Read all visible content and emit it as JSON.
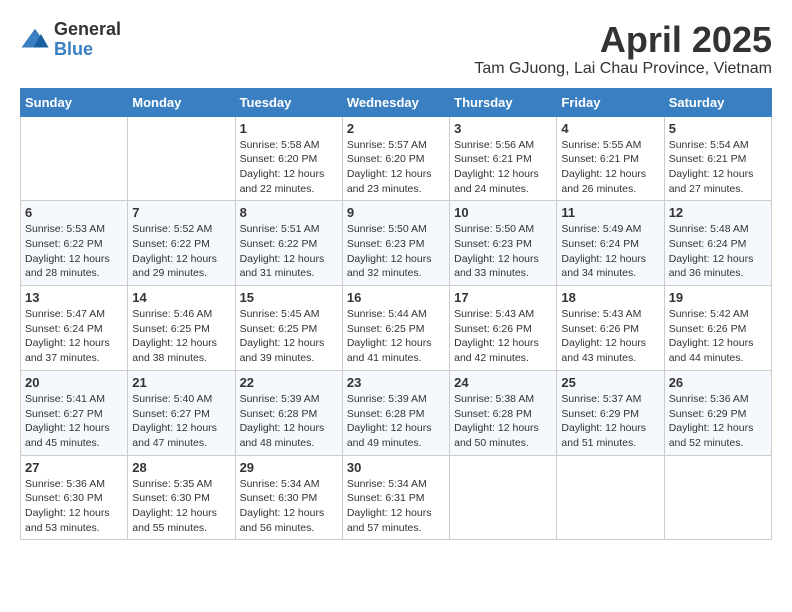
{
  "logo": {
    "general": "General",
    "blue": "Blue"
  },
  "header": {
    "month": "April 2025",
    "location": "Tam GJuong, Lai Chau Province, Vietnam"
  },
  "weekdays": [
    "Sunday",
    "Monday",
    "Tuesday",
    "Wednesday",
    "Thursday",
    "Friday",
    "Saturday"
  ],
  "weeks": [
    [
      {
        "day": "",
        "content": ""
      },
      {
        "day": "",
        "content": ""
      },
      {
        "day": "1",
        "content": "Sunrise: 5:58 AM\nSunset: 6:20 PM\nDaylight: 12 hours and 22 minutes."
      },
      {
        "day": "2",
        "content": "Sunrise: 5:57 AM\nSunset: 6:20 PM\nDaylight: 12 hours and 23 minutes."
      },
      {
        "day": "3",
        "content": "Sunrise: 5:56 AM\nSunset: 6:21 PM\nDaylight: 12 hours and 24 minutes."
      },
      {
        "day": "4",
        "content": "Sunrise: 5:55 AM\nSunset: 6:21 PM\nDaylight: 12 hours and 26 minutes."
      },
      {
        "day": "5",
        "content": "Sunrise: 5:54 AM\nSunset: 6:21 PM\nDaylight: 12 hours and 27 minutes."
      }
    ],
    [
      {
        "day": "6",
        "content": "Sunrise: 5:53 AM\nSunset: 6:22 PM\nDaylight: 12 hours and 28 minutes."
      },
      {
        "day": "7",
        "content": "Sunrise: 5:52 AM\nSunset: 6:22 PM\nDaylight: 12 hours and 29 minutes."
      },
      {
        "day": "8",
        "content": "Sunrise: 5:51 AM\nSunset: 6:22 PM\nDaylight: 12 hours and 31 minutes."
      },
      {
        "day": "9",
        "content": "Sunrise: 5:50 AM\nSunset: 6:23 PM\nDaylight: 12 hours and 32 minutes."
      },
      {
        "day": "10",
        "content": "Sunrise: 5:50 AM\nSunset: 6:23 PM\nDaylight: 12 hours and 33 minutes."
      },
      {
        "day": "11",
        "content": "Sunrise: 5:49 AM\nSunset: 6:24 PM\nDaylight: 12 hours and 34 minutes."
      },
      {
        "day": "12",
        "content": "Sunrise: 5:48 AM\nSunset: 6:24 PM\nDaylight: 12 hours and 36 minutes."
      }
    ],
    [
      {
        "day": "13",
        "content": "Sunrise: 5:47 AM\nSunset: 6:24 PM\nDaylight: 12 hours and 37 minutes."
      },
      {
        "day": "14",
        "content": "Sunrise: 5:46 AM\nSunset: 6:25 PM\nDaylight: 12 hours and 38 minutes."
      },
      {
        "day": "15",
        "content": "Sunrise: 5:45 AM\nSunset: 6:25 PM\nDaylight: 12 hours and 39 minutes."
      },
      {
        "day": "16",
        "content": "Sunrise: 5:44 AM\nSunset: 6:25 PM\nDaylight: 12 hours and 41 minutes."
      },
      {
        "day": "17",
        "content": "Sunrise: 5:43 AM\nSunset: 6:26 PM\nDaylight: 12 hours and 42 minutes."
      },
      {
        "day": "18",
        "content": "Sunrise: 5:43 AM\nSunset: 6:26 PM\nDaylight: 12 hours and 43 minutes."
      },
      {
        "day": "19",
        "content": "Sunrise: 5:42 AM\nSunset: 6:26 PM\nDaylight: 12 hours and 44 minutes."
      }
    ],
    [
      {
        "day": "20",
        "content": "Sunrise: 5:41 AM\nSunset: 6:27 PM\nDaylight: 12 hours and 45 minutes."
      },
      {
        "day": "21",
        "content": "Sunrise: 5:40 AM\nSunset: 6:27 PM\nDaylight: 12 hours and 47 minutes."
      },
      {
        "day": "22",
        "content": "Sunrise: 5:39 AM\nSunset: 6:28 PM\nDaylight: 12 hours and 48 minutes."
      },
      {
        "day": "23",
        "content": "Sunrise: 5:39 AM\nSunset: 6:28 PM\nDaylight: 12 hours and 49 minutes."
      },
      {
        "day": "24",
        "content": "Sunrise: 5:38 AM\nSunset: 6:28 PM\nDaylight: 12 hours and 50 minutes."
      },
      {
        "day": "25",
        "content": "Sunrise: 5:37 AM\nSunset: 6:29 PM\nDaylight: 12 hours and 51 minutes."
      },
      {
        "day": "26",
        "content": "Sunrise: 5:36 AM\nSunset: 6:29 PM\nDaylight: 12 hours and 52 minutes."
      }
    ],
    [
      {
        "day": "27",
        "content": "Sunrise: 5:36 AM\nSunset: 6:30 PM\nDaylight: 12 hours and 53 minutes."
      },
      {
        "day": "28",
        "content": "Sunrise: 5:35 AM\nSunset: 6:30 PM\nDaylight: 12 hours and 55 minutes."
      },
      {
        "day": "29",
        "content": "Sunrise: 5:34 AM\nSunset: 6:30 PM\nDaylight: 12 hours and 56 minutes."
      },
      {
        "day": "30",
        "content": "Sunrise: 5:34 AM\nSunset: 6:31 PM\nDaylight: 12 hours and 57 minutes."
      },
      {
        "day": "",
        "content": ""
      },
      {
        "day": "",
        "content": ""
      },
      {
        "day": "",
        "content": ""
      }
    ]
  ]
}
